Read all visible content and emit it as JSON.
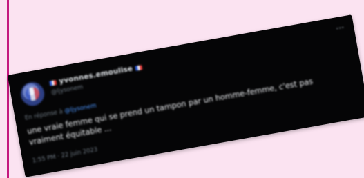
{
  "tweet": {
    "display_name": "yvonnes.emoulise",
    "handle": "@ljysonem",
    "reply_prefix": "En réponse à",
    "reply_target": "@ljysonem",
    "text": "une vraie femme qui se prend un tampon par un homme-femme, c'est pas vraiment équitable ...",
    "timestamp": "1:55 PM · 22 juin 2023"
  }
}
